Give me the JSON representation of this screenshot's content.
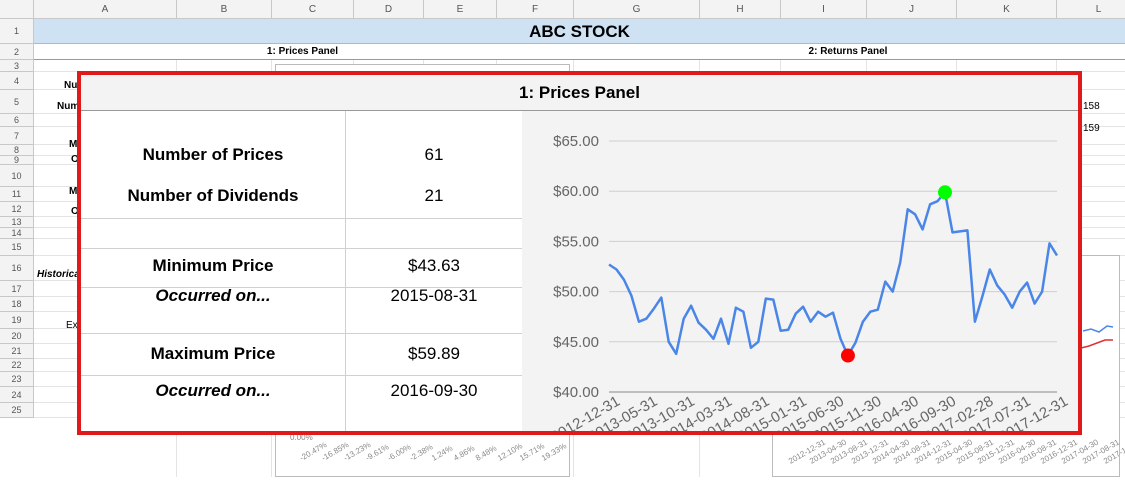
{
  "sheet": {
    "columns": [
      "A",
      "B",
      "C",
      "D",
      "E",
      "F",
      "G",
      "H",
      "I",
      "J",
      "K",
      "L"
    ],
    "rows": [
      "1",
      "2",
      "3",
      "4",
      "5",
      "6",
      "7",
      "8",
      "9",
      "10",
      "11",
      "12",
      "13",
      "14",
      "15",
      "16",
      "17",
      "18",
      "19",
      "20",
      "21",
      "22",
      "23",
      "24",
      "25"
    ],
    "title": "ABC STOCK",
    "prices_panel_header": "1: Prices Panel",
    "returns_panel_header": "2: Returns Panel",
    "partial_text": {
      "a4": "Nu",
      "a5": "Num",
      "a7": "M",
      "a8": "O",
      "a10": "M",
      "a11": "O",
      "a15": "Historica",
      "a17": "Ex",
      "l5": "158",
      "l6": "159"
    },
    "bg_hist_ticks": [
      "-20.47%",
      "-16.85%",
      "-13.23%",
      "-9.61%",
      "-6.00%",
      "-2.38%",
      "1.24%",
      "4.86%",
      "8.48%",
      "12.10%",
      "15.71%",
      "19.33%"
    ],
    "bg_returns_ticks": [
      "2012-12-31",
      "2013-04-30",
      "2013-08-31",
      "2013-12-31",
      "2014-04-30",
      "2014-08-31",
      "2014-12-31",
      "2015-04-30",
      "2015-08-31",
      "2015-12-31",
      "2016-04-30",
      "2016-08-31",
      "2016-12-31",
      "2017-04-30",
      "2017-08-31",
      "2017-12-31"
    ],
    "bg_pct_label": "0.00%"
  },
  "panel": {
    "title": "1: Prices Panel",
    "stats": [
      {
        "label": "Number of Prices",
        "value": "61",
        "italic": false
      },
      {
        "label": "Number of Dividends",
        "value": "21",
        "italic": false
      },
      {
        "label": "Minimum Price",
        "value": "$43.63",
        "italic": false
      },
      {
        "label": "Occurred on...",
        "value": "2015-08-31",
        "italic": true
      },
      {
        "label": "Maximum Price",
        "value": "$59.89",
        "italic": false
      },
      {
        "label": "Occurred on...",
        "value": "2016-09-30",
        "italic": true
      }
    ]
  },
  "chart_data": {
    "type": "line",
    "ylim": [
      40,
      65
    ],
    "yticks": [
      "$40.00",
      "$45.00",
      "$50.00",
      "$55.00",
      "$60.00",
      "$65.00"
    ],
    "ytick_values": [
      40,
      45,
      50,
      55,
      60,
      65
    ],
    "xticks": [
      "2012-12-31",
      "2013-05-31",
      "2013-10-31",
      "2014-03-31",
      "2014-08-31",
      "2015-01-31",
      "2015-06-30",
      "2015-11-30",
      "2016-04-30",
      "2016-09-30",
      "2017-02-28",
      "2017-07-31",
      "2017-12-31"
    ],
    "values": [
      52.7,
      52.2,
      51.2,
      49.6,
      47.0,
      47.3,
      48.3,
      49.4,
      45.0,
      43.8,
      47.3,
      48.6,
      46.9,
      46.2,
      45.3,
      47.3,
      44.8,
      48.4,
      48.0,
      44.4,
      45.0,
      49.3,
      49.2,
      46.1,
      46.2,
      47.8,
      48.5,
      47.0,
      48.0,
      47.5,
      47.9,
      45.3,
      43.63,
      44.9,
      47.0,
      48.0,
      48.2,
      51.0,
      50.0,
      52.9,
      58.2,
      57.7,
      56.2,
      58.7,
      59.0,
      59.89,
      55.9,
      56.0,
      56.1,
      47.0,
      49.5,
      52.2,
      50.6,
      49.7,
      48.4,
      50.0,
      50.9,
      48.8,
      50.0,
      54.8,
      53.6
    ],
    "line_color": "#4a86e8",
    "min_marker": {
      "index": 32,
      "value": 43.63,
      "color": "#ff0000"
    },
    "max_marker": {
      "index": 45,
      "value": 59.89,
      "color": "#00ff00"
    },
    "grid": true,
    "legend": "none"
  }
}
